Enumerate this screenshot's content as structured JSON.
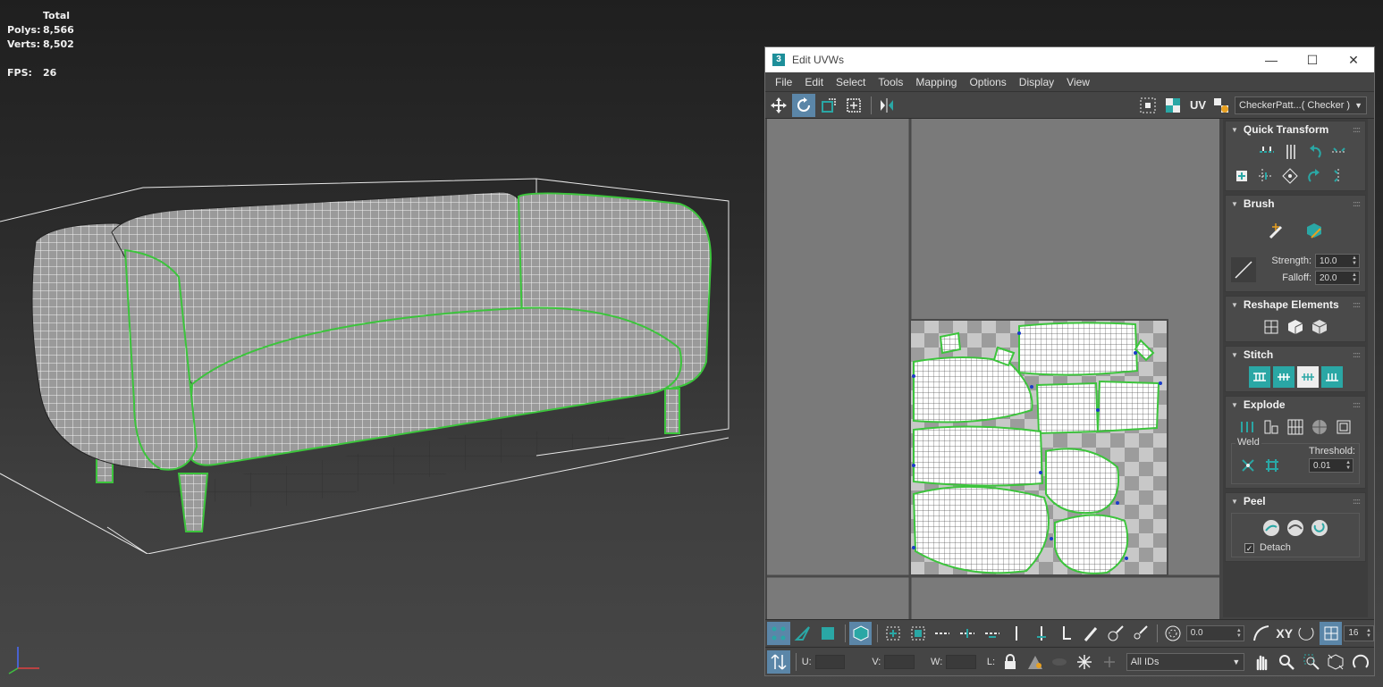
{
  "viewport": {
    "stats": {
      "total_label": "Total",
      "polys_label": "Polys:",
      "polys_value": "8,566",
      "verts_label": "Verts:",
      "verts_value": "8,502",
      "fps_label": "FPS:",
      "fps_value": "26"
    }
  },
  "window": {
    "title": "Edit UVWs",
    "app_icon_letter": "3",
    "minimize_glyph": "—",
    "maximize_glyph": "☐",
    "close_glyph": "✕"
  },
  "menu": [
    "File",
    "Edit",
    "Select",
    "Tools",
    "Mapping",
    "Options",
    "Display",
    "View"
  ],
  "toolbar": {
    "uv_label": "UV",
    "checker_dropdown": "CheckerPatt...( Checker )"
  },
  "panel": {
    "quick_transform": {
      "title": "Quick Transform"
    },
    "brush": {
      "title": "Brush",
      "strength_label": "Strength:",
      "strength_value": "10.0",
      "falloff_label": "Falloff:",
      "falloff_value": "20.0"
    },
    "reshape": {
      "title": "Reshape Elements"
    },
    "stitch": {
      "title": "Stitch"
    },
    "explode": {
      "title": "Explode",
      "weld_label": "Weld",
      "threshold_label": "Threshold:",
      "threshold_value": "0.01"
    },
    "peel": {
      "title": "Peel",
      "detach_label": "Detach",
      "detach_checked": true
    }
  },
  "bottom": {
    "rotation_value": "0.0",
    "xy_label": "XY",
    "grid_value": "16",
    "u_label": "U:",
    "v_label": "V:",
    "w_label": "W:",
    "l_label": "L:",
    "ids_dropdown": "All IDs"
  },
  "colors": {
    "accent_teal": "#2aa7a5",
    "seam_green": "#3cc43c",
    "uv_background": "#7a7a7a",
    "vertex_blue": "#1a3cc8"
  }
}
